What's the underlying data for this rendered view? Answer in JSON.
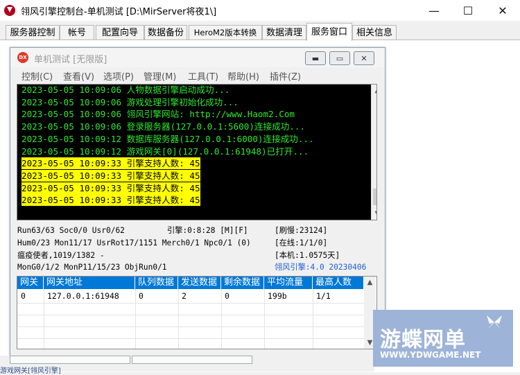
{
  "window": {
    "title": "翎风引擎控制台-单机测试 [D:\\MirServer将夜1\\]",
    "minimize": "—",
    "maximize": "☐",
    "close": "✕"
  },
  "tabs": [
    {
      "label": "服务器控制"
    },
    {
      "label": "帐号"
    },
    {
      "label": "配置向导"
    },
    {
      "label": "数据备份"
    },
    {
      "label": "HeroM2版本转换"
    },
    {
      "label": "数据清理"
    },
    {
      "label": "服务窗口"
    },
    {
      "label": "相关信息"
    }
  ],
  "inner": {
    "icon_text": "DX",
    "title": "单机测试 [无限版]",
    "menu": [
      "控制(C)",
      "查看(V)",
      "选项(P)",
      "管理(M)",
      "工具(T)",
      "帮助(H)",
      "插件(Z)"
    ]
  },
  "log": [
    {
      "text": "2023-05-05 10:09:06 人物数据引擎启动成功...",
      "highlight": false
    },
    {
      "text": "2023-05-05 10:09:06 游戏处理引擎初始化成功...",
      "highlight": false
    },
    {
      "text": "2023-05-05 10:09:06 翎风引擎网站: http://www.Haom2.Com",
      "highlight": false
    },
    {
      "text": "2023-05-05 10:09:06 登录服务器(127.0.0.1:5600)连接成功...",
      "highlight": false
    },
    {
      "text": "2023-05-05 10:09:12 数据库服务器(127.0.0.1:6000)连接成功...",
      "highlight": false
    },
    {
      "text": "2023-05-05 10:09:12 游戏网关[0](127.0.0.1:61948)已打开...",
      "highlight": false
    },
    {
      "text": "2023-05-05 10:09:33 引擎支持人数: 45",
      "highlight": true
    },
    {
      "text": "2023-05-05 10:09:33 引擎支持人数: 45",
      "highlight": true
    },
    {
      "text": "2023-05-05 10:09:33 引擎支持人数: 45",
      "highlight": true
    },
    {
      "text": "2023-05-05 10:09:33 引擎支持人数: 45",
      "highlight": true
    }
  ],
  "status": {
    "line1": "Run63/63 Soc0/0 Usr0/62",
    "engine": "引擎:0:8:28 [M][F]",
    "refresh": "[刷慢:23124]",
    "line2": "Hum0/23 Mon11/17 UsrRot17/1151 Merch0/1 Npc0/1 (0)",
    "online": "[在线:1/1/0]",
    "line3": "瘟疫使者,1019/1382 -",
    "local": "[本机:1.0575天]",
    "line4": "MonG0/1/2 MonP11/15/23 ObjRun0/1",
    "version": "翎风引擎:4.0 20230406"
  },
  "gateway_table": {
    "headers": [
      "网关",
      "网关地址",
      "队列数据",
      "发送数据",
      "剩余数据",
      "平均流量",
      "最高人数"
    ],
    "rows": [
      [
        "0",
        "127.0.0.1:61948",
        "0",
        "2",
        "0",
        "199b",
        "1/1"
      ]
    ]
  },
  "bottom_text": "游戏网关[翎风引擎]",
  "watermark": {
    "title": "游蝶网单",
    "url": "WWW.YDWGAME.NET"
  }
}
